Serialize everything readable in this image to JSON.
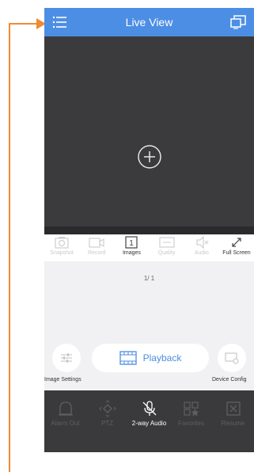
{
  "annotation": {
    "color": "#f08a34"
  },
  "header": {
    "title": "Live View",
    "background": "#4d8ee5"
  },
  "video": {
    "add_button_icon": "plus-circle-icon"
  },
  "toolbar": [
    {
      "label": "Snapshot",
      "icon": "camera-icon",
      "active": false
    },
    {
      "label": "Record",
      "icon": "video-record-icon",
      "active": false
    },
    {
      "label": "Images",
      "icon": "grid-one-icon",
      "active": true
    },
    {
      "label": "Quality",
      "icon": "quality-icon",
      "active": false
    },
    {
      "label": "Audio",
      "icon": "speaker-icon",
      "active": false
    },
    {
      "label": "Full Screen",
      "icon": "expand-icon",
      "active": true
    }
  ],
  "pager": {
    "text": "1/ 1"
  },
  "controls": {
    "playback_label": "Playback",
    "image_settings_label": "Image Settings",
    "device_config_label": "Device Config"
  },
  "bottom_tabs": [
    {
      "label": "Alarm Out",
      "icon": "alarm-bell-icon",
      "active": false
    },
    {
      "label": "PTZ",
      "icon": "ptz-icon",
      "active": false
    },
    {
      "label": "2-way Audio",
      "icon": "microphone-muted-icon",
      "active": true
    },
    {
      "label": "Favorites",
      "icon": "favorites-icon",
      "active": false
    },
    {
      "label": "Resume",
      "icon": "resume-icon",
      "active": false
    }
  ]
}
